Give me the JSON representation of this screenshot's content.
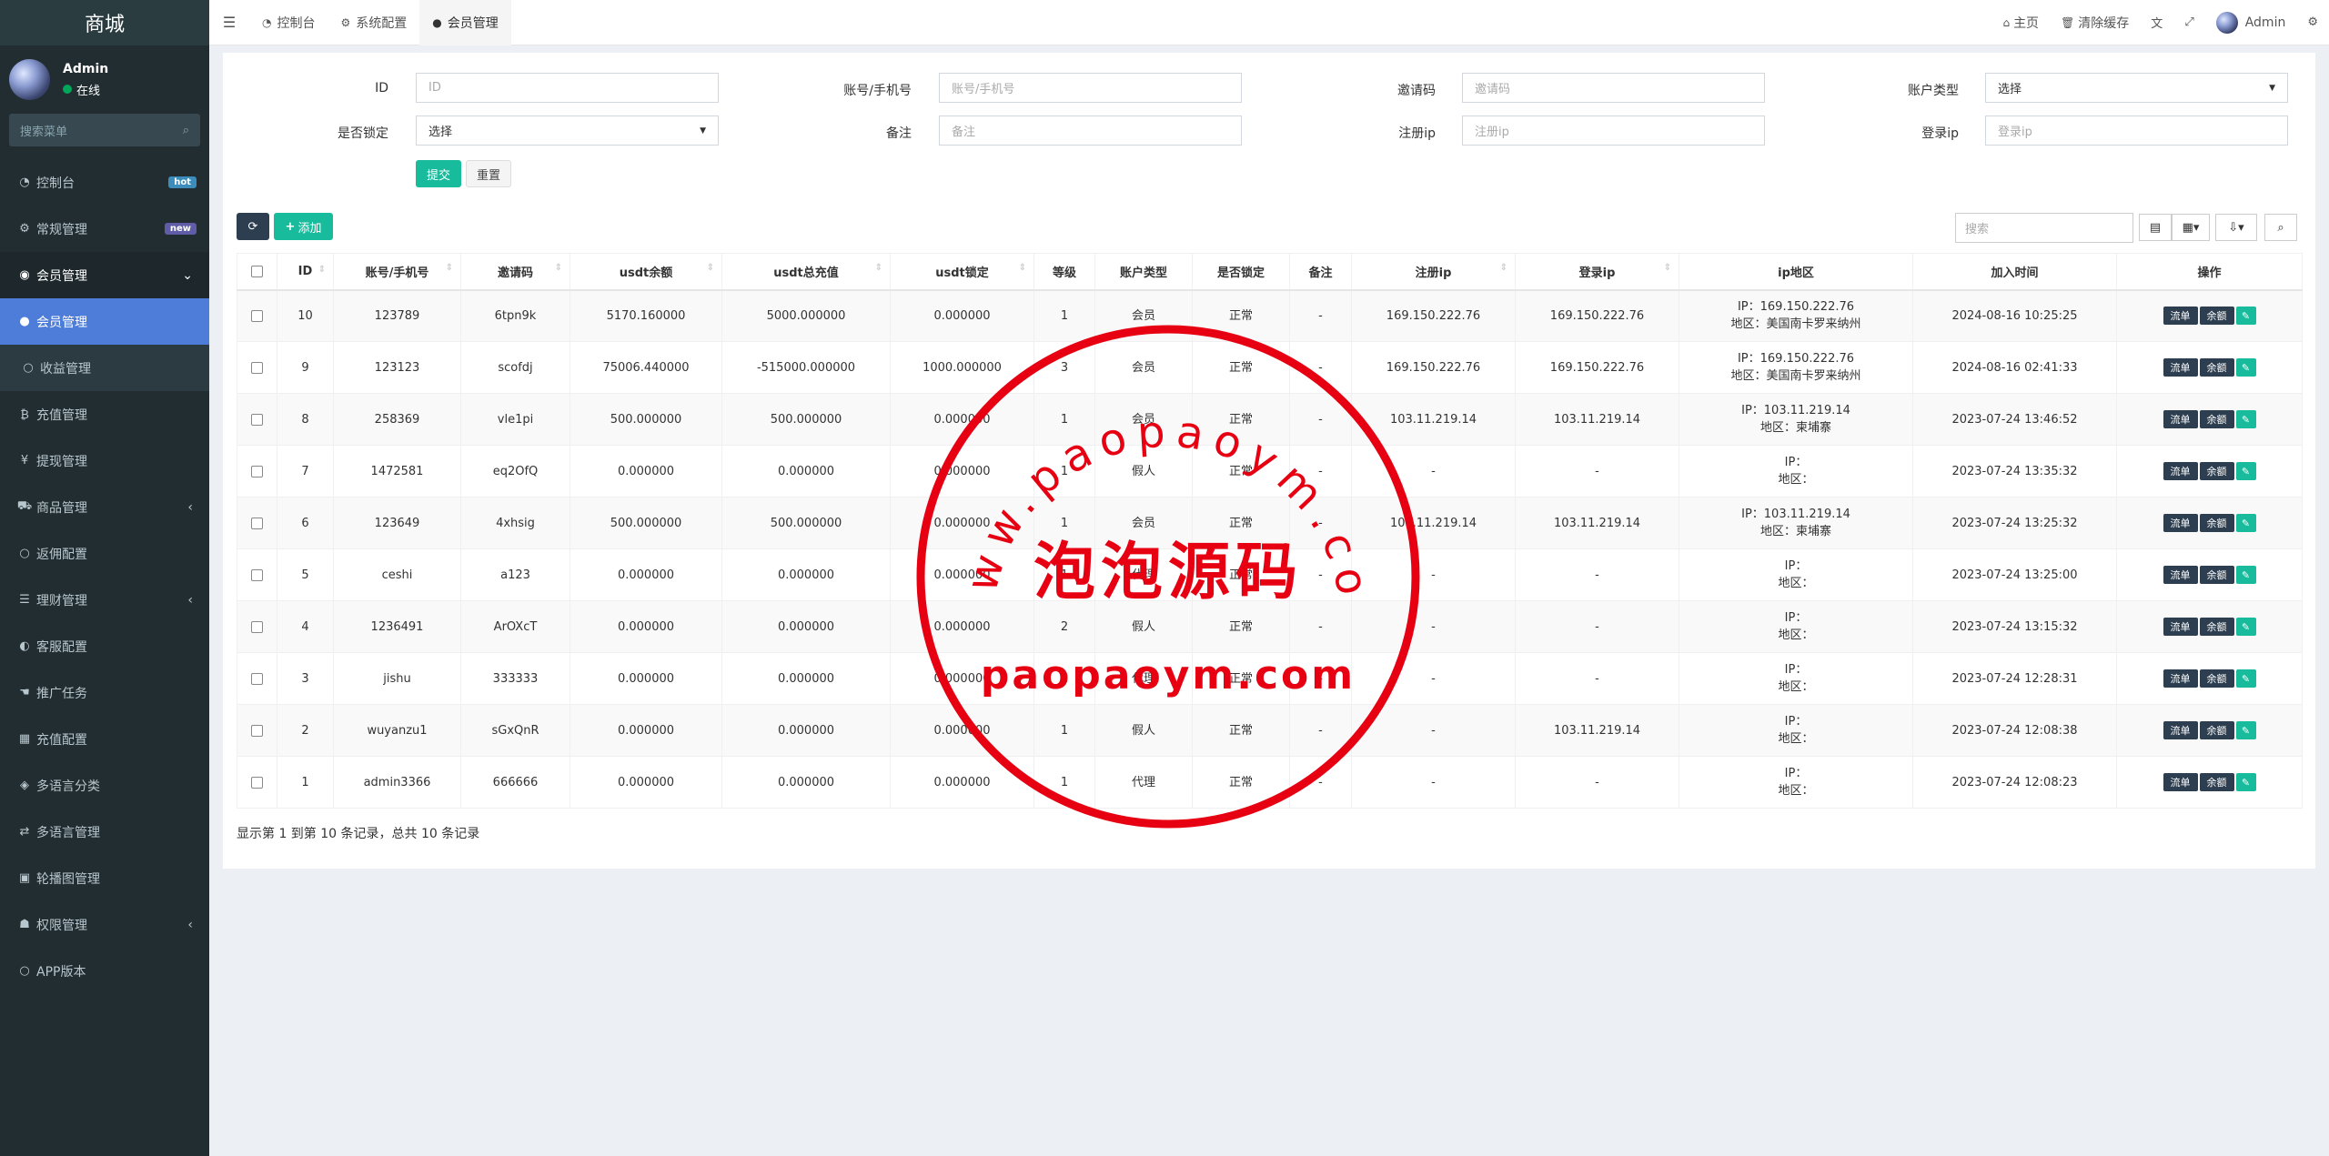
{
  "sidebar": {
    "brand": "商城",
    "user": {
      "name": "Admin",
      "status": "在线"
    },
    "search_placeholder": "搜索菜单",
    "items": [
      {
        "icon": "dashboard-icon",
        "glyph": "◔",
        "label": "控制台",
        "badge": "hot",
        "badge_color": "#3c8dbc"
      },
      {
        "icon": "cogs-icon",
        "glyph": "⚙",
        "label": "常规管理",
        "badge": "new",
        "badge_color": "#605ca8"
      },
      {
        "icon": "user-circle-icon",
        "glyph": "◉",
        "label": "会员管理",
        "chevron": "⌄",
        "state": "open"
      },
      {
        "icon": "user-icon",
        "glyph": "●",
        "label": "会员管理",
        "state": "active"
      },
      {
        "icon": "circle-icon",
        "glyph": "○",
        "label": "收益管理",
        "state": "sub"
      },
      {
        "icon": "bitcoin-icon",
        "glyph": "₿",
        "label": "充值管理"
      },
      {
        "icon": "yen-icon",
        "glyph": "¥",
        "label": "提现管理"
      },
      {
        "icon": "cart-icon",
        "glyph": "⛟",
        "label": "商品管理",
        "chevron": "‹"
      },
      {
        "icon": "circle-icon",
        "glyph": "○",
        "label": "返佣配置"
      },
      {
        "icon": "list-icon",
        "glyph": "☰",
        "label": "理财管理",
        "chevron": "‹"
      },
      {
        "icon": "headset-icon",
        "glyph": "◐",
        "label": "客服配置"
      },
      {
        "icon": "hand-icon",
        "glyph": "☚",
        "label": "推广任务"
      },
      {
        "icon": "table-icon",
        "glyph": "▦",
        "label": "充值配置"
      },
      {
        "icon": "tag-icon",
        "glyph": "◈",
        "label": "多语言分类"
      },
      {
        "icon": "language-icon",
        "glyph": "⇄",
        "label": "多语言管理"
      },
      {
        "icon": "image-icon",
        "glyph": "▣",
        "label": "轮播图管理"
      },
      {
        "icon": "group-icon",
        "glyph": "☗",
        "label": "权限管理",
        "chevron": "‹"
      },
      {
        "icon": "circle-icon",
        "glyph": "○",
        "label": "APP版本"
      }
    ]
  },
  "topbar": {
    "tabs": [
      {
        "icon": "dashboard-icon",
        "glyph": "◔",
        "label": "控制台"
      },
      {
        "icon": "cog-icon",
        "glyph": "⚙",
        "label": "系统配置"
      },
      {
        "icon": "user-icon",
        "glyph": "●",
        "label": "会员管理",
        "active": true
      }
    ],
    "home": "主页",
    "clear_cache": "清除缓存",
    "admin": "Admin"
  },
  "filters": {
    "id_label": "ID",
    "id_placeholder": "ID",
    "account_label": "账号/手机号",
    "account_placeholder": "账号/手机号",
    "invite_label": "邀请码",
    "invite_placeholder": "邀请码",
    "type_label": "账户类型",
    "type_value": "选择",
    "locked_label": "是否锁定",
    "locked_value": "选择",
    "remark_label": "备注",
    "remark_placeholder": "备注",
    "reg_ip_label": "注册ip",
    "reg_ip_placeholder": "注册ip",
    "login_ip_label": "登录ip",
    "login_ip_placeholder": "登录ip",
    "submit": "提交",
    "reset": "重置"
  },
  "toolbar": {
    "add": "添加",
    "search_placeholder": "搜索"
  },
  "table": {
    "headers": [
      "ID",
      "账号/手机号",
      "邀请码",
      "usdt余额",
      "usdt总充值",
      "usdt锁定",
      "等级",
      "账户类型",
      "是否锁定",
      "备注",
      "注册ip",
      "登录ip",
      "ip地区",
      "加入时间",
      "操作"
    ],
    "op_labels": [
      "流单",
      "余额"
    ],
    "rows": [
      {
        "id": "10",
        "account": "123789",
        "invite": "6tpn9k",
        "balance": "5170.160000",
        "recharge": "5000.000000",
        "locked_amt": "0.000000",
        "level": "1",
        "type": "会员",
        "lock": "正常",
        "remark": "-",
        "reg_ip": "169.150.222.76",
        "login_ip": "169.150.222.76",
        "ip_line": "IP：169.150.222.76",
        "region_line": "地区：美国南卡罗来纳州",
        "time": "2024-08-16 10:25:25"
      },
      {
        "id": "9",
        "account": "123123",
        "invite": "scofdj",
        "balance": "75006.440000",
        "recharge": "-515000.000000",
        "locked_amt": "1000.000000",
        "level": "3",
        "type": "会员",
        "lock": "正常",
        "remark": "-",
        "reg_ip": "169.150.222.76",
        "login_ip": "169.150.222.76",
        "ip_line": "IP：169.150.222.76",
        "region_line": "地区：美国南卡罗来纳州",
        "time": "2024-08-16 02:41:33"
      },
      {
        "id": "8",
        "account": "258369",
        "invite": "vle1pi",
        "balance": "500.000000",
        "recharge": "500.000000",
        "locked_amt": "0.000000",
        "level": "1",
        "type": "会员",
        "lock": "正常",
        "remark": "-",
        "reg_ip": "103.11.219.14",
        "login_ip": "103.11.219.14",
        "ip_line": "IP：103.11.219.14",
        "region_line": "地区：柬埔寨",
        "time": "2023-07-24 13:46:52"
      },
      {
        "id": "7",
        "account": "1472581",
        "invite": "eq2OfQ",
        "balance": "0.000000",
        "recharge": "0.000000",
        "locked_amt": "0.000000",
        "level": "1",
        "type": "假人",
        "lock": "正常",
        "remark": "-",
        "reg_ip": "-",
        "login_ip": "-",
        "ip_line": "IP：",
        "region_line": "地区：",
        "time": "2023-07-24 13:35:32"
      },
      {
        "id": "6",
        "account": "123649",
        "invite": "4xhsig",
        "balance": "500.000000",
        "recharge": "500.000000",
        "locked_amt": "0.000000",
        "level": "1",
        "type": "会员",
        "lock": "正常",
        "remark": "-",
        "reg_ip": "103.11.219.14",
        "login_ip": "103.11.219.14",
        "ip_line": "IP：103.11.219.14",
        "region_line": "地区：柬埔寨",
        "time": "2023-07-24 13:25:32"
      },
      {
        "id": "5",
        "account": "ceshi",
        "invite": "a123",
        "balance": "0.000000",
        "recharge": "0.000000",
        "locked_amt": "0.000000",
        "level": "1",
        "type": "代理",
        "lock": "正常",
        "remark": "-",
        "reg_ip": "-",
        "login_ip": "-",
        "ip_line": "IP：",
        "region_line": "地区：",
        "time": "2023-07-24 13:25:00"
      },
      {
        "id": "4",
        "account": "1236491",
        "invite": "ArOXcT",
        "balance": "0.000000",
        "recharge": "0.000000",
        "locked_amt": "0.000000",
        "level": "2",
        "type": "假人",
        "lock": "正常",
        "remark": "-",
        "reg_ip": "-",
        "login_ip": "-",
        "ip_line": "IP：",
        "region_line": "地区：",
        "time": "2023-07-24 13:15:32"
      },
      {
        "id": "3",
        "account": "jishu",
        "invite": "333333",
        "balance": "0.000000",
        "recharge": "0.000000",
        "locked_amt": "0.000000",
        "level": "2",
        "type": "代理",
        "lock": "正常",
        "remark": "-",
        "reg_ip": "-",
        "login_ip": "-",
        "ip_line": "IP：",
        "region_line": "地区：",
        "time": "2023-07-24 12:28:31"
      },
      {
        "id": "2",
        "account": "wuyanzu1",
        "invite": "sGxQnR",
        "balance": "0.000000",
        "recharge": "0.000000",
        "locked_amt": "0.000000",
        "level": "1",
        "type": "假人",
        "lock": "正常",
        "remark": "-",
        "reg_ip": "-",
        "login_ip": "103.11.219.14",
        "ip_line": "IP：",
        "region_line": "地区：",
        "time": "2023-07-24 12:08:38"
      },
      {
        "id": "1",
        "account": "admin3366",
        "invite": "666666",
        "balance": "0.000000",
        "recharge": "0.000000",
        "locked_amt": "0.000000",
        "level": "1",
        "type": "代理",
        "lock": "正常",
        "remark": "-",
        "reg_ip": "-",
        "login_ip": "-",
        "ip_line": "IP：",
        "region_line": "地区：",
        "time": "2023-07-24 12:08:23"
      }
    ]
  },
  "footer": {
    "summary": "显示第 1 到第 10 条记录，总共 10 条记录"
  },
  "watermark": {
    "top_text": "www.paopaoym.com",
    "center_text": "泡泡源码",
    "bottom_text": "paopaoym.com",
    "color": "#e60012"
  }
}
